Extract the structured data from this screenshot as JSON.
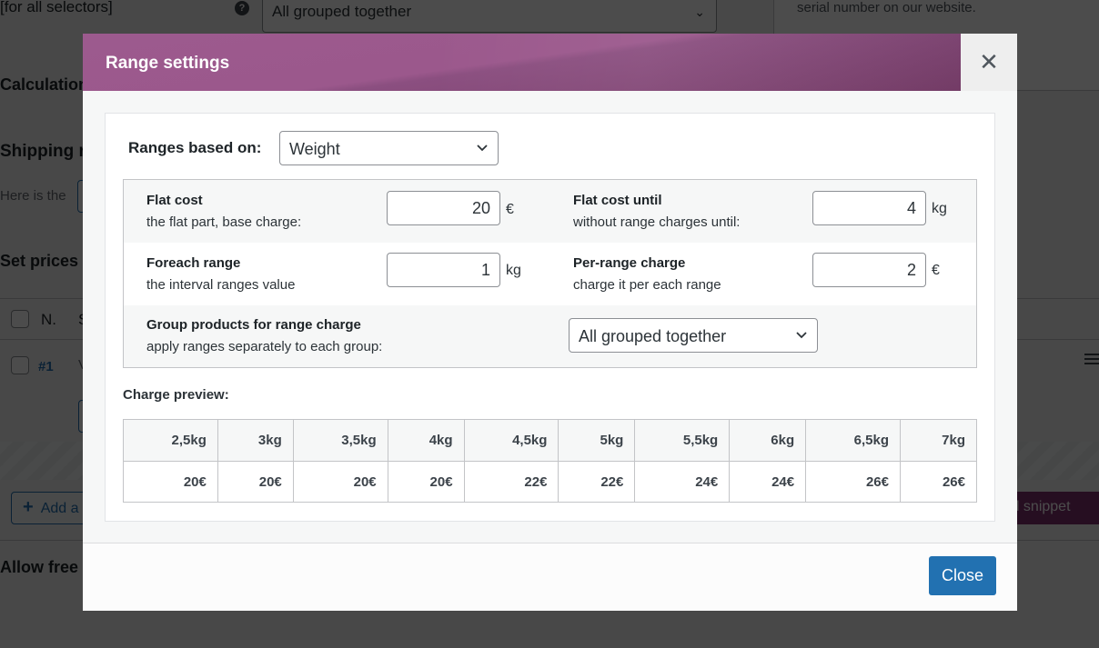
{
  "background": {
    "selectors_label": "[for all selectors]",
    "help_icon": "question-circle-icon",
    "grouping_select_value": "All grouped together",
    "right_panel_text": "serial number on our website.",
    "calculation_label": "Calculation",
    "shipping_rules_label": "Shipping ru",
    "here_is_the_text": "Here is the",
    "set_prices_label": "Set prices fo",
    "table_header_number": "N.",
    "table_header_s": "S",
    "row_link": "#1",
    "row_text": "V",
    "add_button_label": "Add a",
    "add_snippet_label": "Add snippet",
    "allow_free_label": "Allow free s"
  },
  "modal": {
    "title": "Range settings",
    "close_icon": "close-x-icon",
    "ranges_based_on": {
      "label": "Ranges based on:",
      "value": "Weight"
    },
    "fields": {
      "flat_cost": {
        "title": "Flat cost",
        "description": "the flat part, base charge:",
        "value": "20",
        "unit": "€"
      },
      "flat_cost_until": {
        "title": "Flat cost until",
        "description": "without range charges until:",
        "value": "4",
        "unit": "kg"
      },
      "foreach_range": {
        "title": "Foreach range",
        "description": "the interval ranges value",
        "value": "1",
        "unit": "kg"
      },
      "per_range_charge": {
        "title": "Per-range charge",
        "description": "charge it per each range",
        "value": "2",
        "unit": "€"
      },
      "group_products": {
        "title": "Group products for range charge",
        "description": "apply ranges separately to each group:",
        "value": "All grouped together"
      }
    },
    "preview": {
      "label": "Charge preview:",
      "weights": [
        "2,5kg",
        "3kg",
        "3,5kg",
        "4kg",
        "4,5kg",
        "5kg",
        "5,5kg",
        "6kg",
        "6,5kg",
        "7kg"
      ],
      "charges": [
        "20€",
        "20€",
        "20€",
        "20€",
        "22€",
        "22€",
        "24€",
        "24€",
        "26€",
        "26€"
      ]
    },
    "footer": {
      "close_label": "Close"
    }
  },
  "colors": {
    "header_purple": "#9c5a8e",
    "primary_blue": "#2271b1",
    "snippet_purple": "#7f2f6f"
  }
}
